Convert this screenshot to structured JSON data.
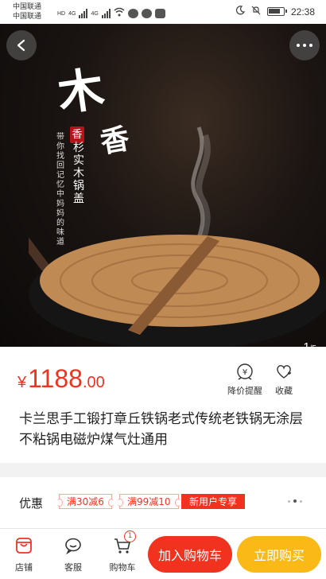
{
  "status_bar": {
    "carrier_1": "中国联通",
    "carrier_2": "中国联通",
    "net_1": "4G",
    "net_2": "4G",
    "hd_badge": "HD",
    "time": "22:38"
  },
  "hero": {
    "brand_big": "木",
    "brand_small": "香",
    "seal_text": "香",
    "vertical_big": "杉实木锅盖",
    "vertical_small": "带你找回记忆中妈妈的味道",
    "counter_current": "1",
    "counter_total": "/5"
  },
  "product": {
    "currency": "¥",
    "price_int": "1188",
    "price_dec": ".00",
    "price_alert_label": "降价提醒",
    "favorite_label": "收藏",
    "title": "卡兰思手工锻打章丘铁锅老式传统老铁锅无涂层不粘锅电磁炉煤气灶通用"
  },
  "promo": {
    "label": "优惠",
    "coupons": [
      "满30减6",
      "满99减10",
      "新用户专享"
    ]
  },
  "bottom_bar": {
    "shop_label": "店铺",
    "service_label": "客服",
    "cart_label": "购物车",
    "cart_count": "1",
    "add_cart_label": "加入购物车",
    "buy_now_label": "立即购买"
  },
  "colors": {
    "accent_red": "#f0321f",
    "buy_yellow": "#fbb917"
  }
}
